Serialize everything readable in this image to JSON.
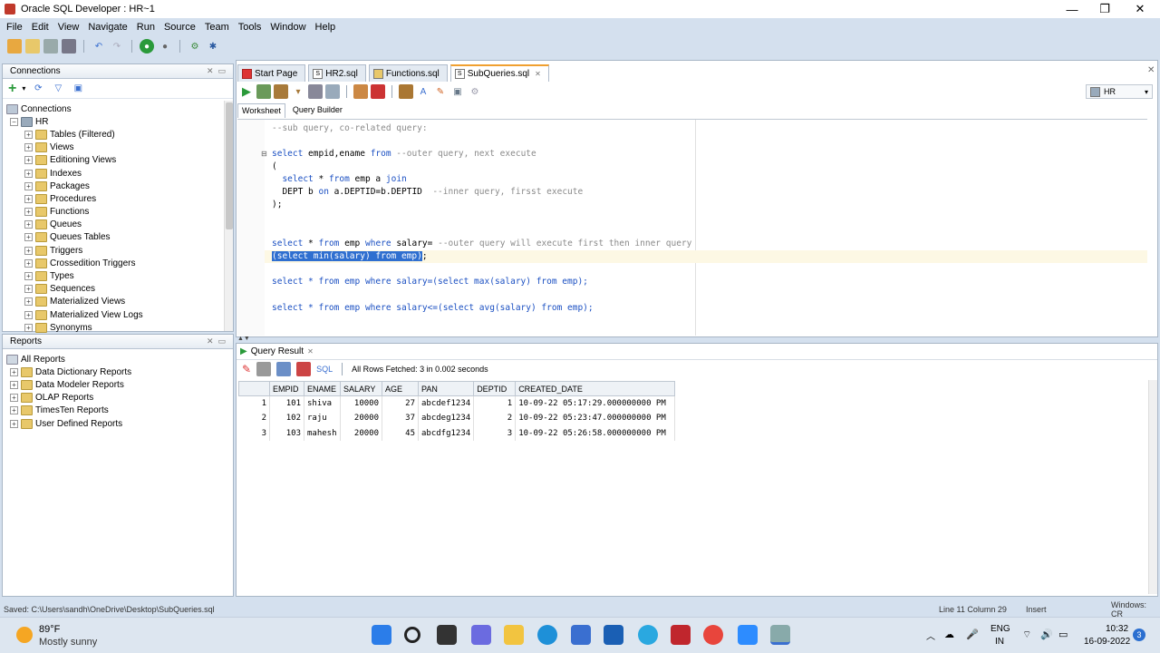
{
  "window": {
    "title": "Oracle SQL Developer : HR~1"
  },
  "menu": [
    "File",
    "Edit",
    "View",
    "Navigate",
    "Run",
    "Source",
    "Team",
    "Tools",
    "Window",
    "Help"
  ],
  "connections_panel": {
    "header": "Connections",
    "root": "Connections",
    "connection": "HR",
    "items": [
      "Tables (Filtered)",
      "Views",
      "Editioning Views",
      "Indexes",
      "Packages",
      "Procedures",
      "Functions",
      "Queues",
      "Queues Tables",
      "Triggers",
      "Crossedition Triggers",
      "Types",
      "Sequences",
      "Materialized Views",
      "Materialized View Logs",
      "Synonyms"
    ]
  },
  "reports_panel": {
    "header": "Reports",
    "root": "All Reports",
    "items": [
      "Data Dictionary Reports",
      "Data Modeler Reports",
      "OLAP Reports",
      "TimesTen Reports",
      "User Defined Reports"
    ]
  },
  "tabs": [
    "Start Page",
    "HR2.sql",
    "Functions.sql",
    "SubQueries.sql"
  ],
  "active_tab": "SubQueries.sql",
  "connection_selector": "HR",
  "worksheet_tabs": [
    "Worksheet",
    "Query Builder"
  ],
  "editor": {
    "lines": {
      "l1": "--sub query, co-related query:",
      "l2a": "select",
      "l2b": " empid,ename ",
      "l2c": "from",
      "l2d": " --outer query, next execute",
      "l3": "(",
      "l4a": "  select",
      "l4b": " * ",
      "l4c": "from",
      "l4d": " emp a ",
      "l4e": "join",
      "l5a": "  DEPT b ",
      "l5b": "on",
      "l5c": " a.DEPTID=b.DEPTID  ",
      "l5d": "--inner query, firsst execute",
      "l6": ");",
      "l7a": "select",
      "l7b": " * ",
      "l7c": "from",
      "l7d": " emp ",
      "l7e": "where",
      "l7f": " salary= ",
      "l7g": "--outer query will execute first then inner query",
      "l8a": "(select min(salary) from emp)",
      "l8b": ";",
      "l9": "select * from emp where salary=(select max(salary) from emp);",
      "l10": "select * from emp where salary<=(select avg(salary) from emp);"
    }
  },
  "results": {
    "tab": "Query Result",
    "sql_label": "SQL",
    "status": "All Rows Fetched: 3 in 0.002 seconds",
    "columns": [
      "EMPID",
      "ENAME",
      "SALARY",
      "AGE",
      "PAN",
      "DEPTID",
      "CREATED_DATE"
    ],
    "rows": [
      [
        "1",
        "101",
        "shiva",
        "10000",
        "27",
        "abcdef1234",
        "1",
        "10-09-22 05:17:29.000000000 PM"
      ],
      [
        "2",
        "102",
        "raju",
        "20000",
        "37",
        "abcdeg1234",
        "2",
        "10-09-22 05:23:47.000000000 PM"
      ],
      [
        "3",
        "103",
        "mahesh",
        "20000",
        "45",
        "abcdfg1234",
        "3",
        "10-09-22 05:26:58.000000000 PM"
      ]
    ]
  },
  "statusbar": {
    "saved": "Saved: C:\\Users\\sandh\\OneDrive\\Desktop\\SubQueries.sql",
    "position": "Line 11 Column 29",
    "mode": "Insert",
    "os": "Windows: CR"
  },
  "taskbar": {
    "temp": "89°F",
    "weather": "Mostly sunny",
    "lang1": "ENG",
    "lang2": "IN",
    "time": "10:32",
    "date": "16-09-2022",
    "badge": "3"
  }
}
